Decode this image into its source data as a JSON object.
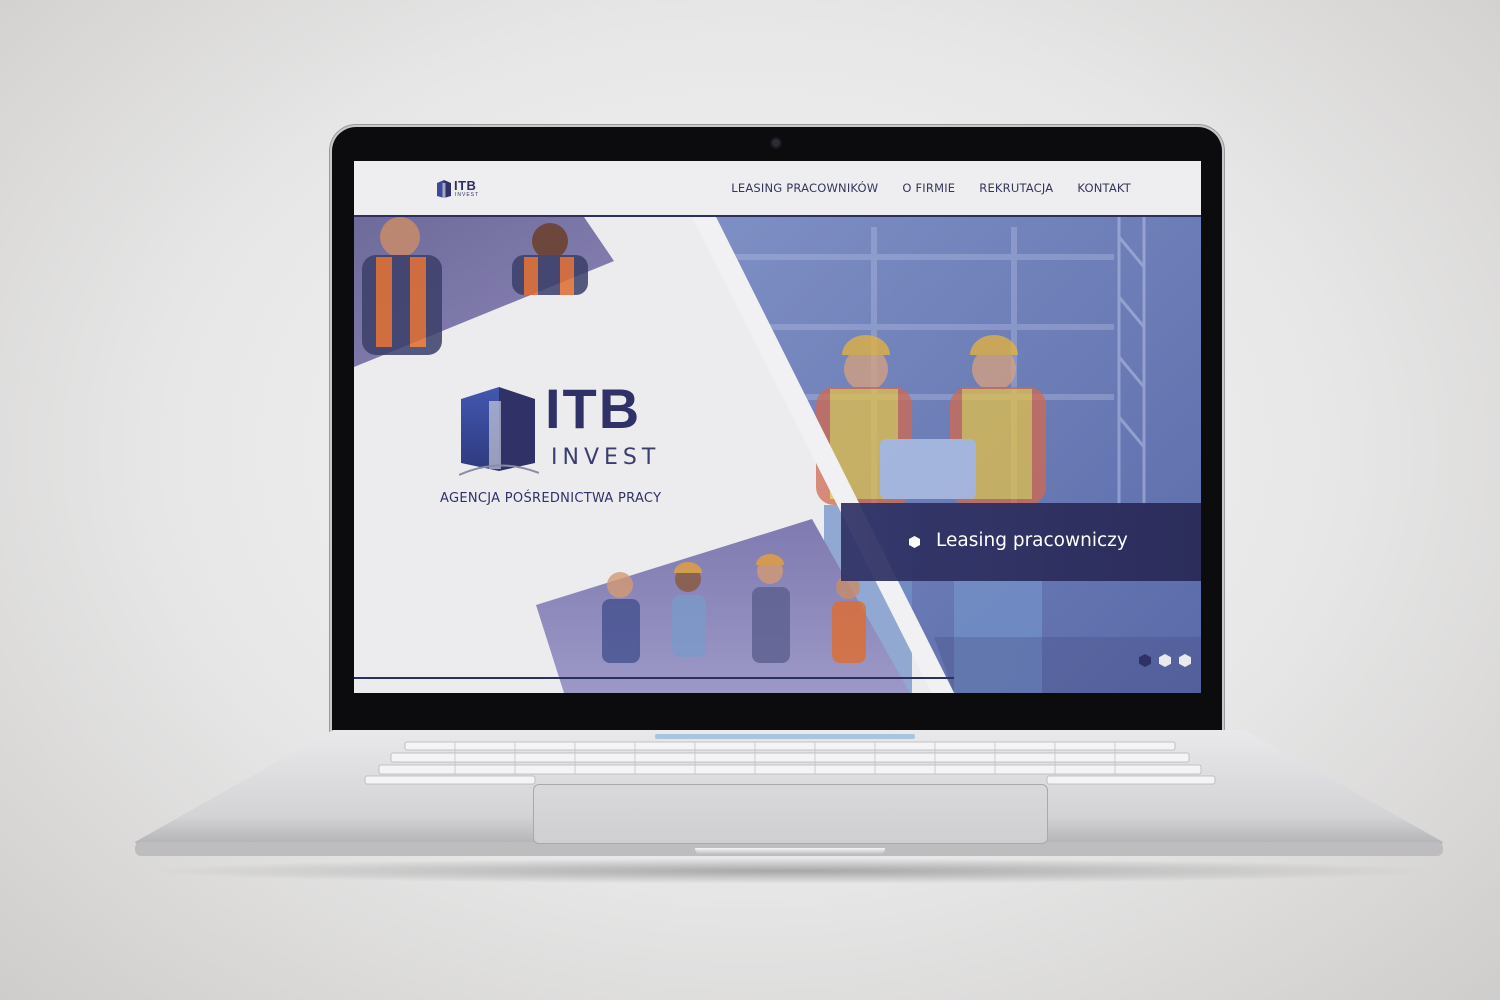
{
  "site": {
    "logo": {
      "main": "ITB",
      "sub": "INVEST"
    },
    "nav": [
      {
        "label": "LEASING PRACOWNIKÓW"
      },
      {
        "label": "O FIRMIE"
      },
      {
        "label": "REKRUTACJA"
      },
      {
        "label": "KONTAKT"
      }
    ],
    "hero": {
      "logo_main": "ITB",
      "logo_sub": "INVEST",
      "tagline": "AGENCJA POŚREDNICTWA PRACY",
      "banner_text": "Leasing pracowniczy",
      "slides": {
        "count": 3,
        "active": 1
      }
    }
  },
  "colors": {
    "brand_navy": "#2f3167",
    "brand_blue": "#3d4a99",
    "hero_overlay": "#6c7bb9",
    "page_bg": "#ececef"
  },
  "icons": [
    "building-logo-icon",
    "hexagon-bullet-icon",
    "hexagon-slider-dot-icon",
    "webcam-icon"
  ]
}
